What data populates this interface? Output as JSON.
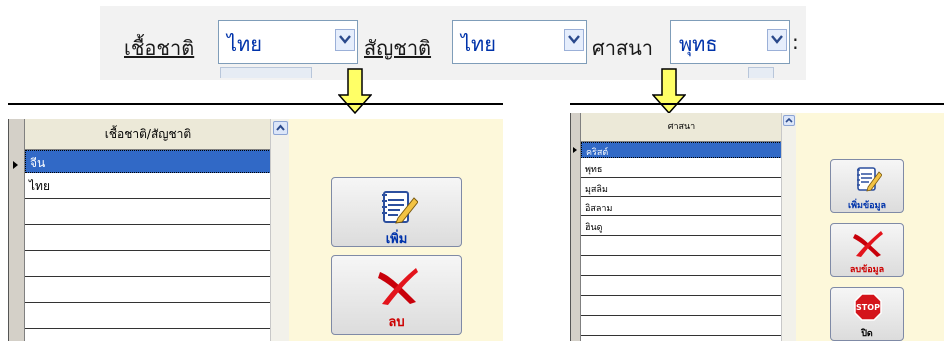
{
  "top_form": {
    "nationality_label": "เชื้อชาติ",
    "nationality_value": "ไทย",
    "citizenship_label": "สัญชาติ",
    "citizenship_value": "ไทย",
    "religion_label": "ศาสนา",
    "religion_value": "พุทธ",
    "trailing_char": ":"
  },
  "left_panel": {
    "column_header": "เชื้อชาติ/สัญชาติ",
    "rows": [
      "จีน",
      "ไทย",
      "",
      "",
      "",
      "",
      "",
      ""
    ],
    "add_button_label": "เพิ่ม",
    "delete_button_label": "ลบ"
  },
  "right_panel": {
    "column_header": "ศาสนา",
    "rows": [
      "คริสต์",
      "พุทธ",
      "มุสลิม",
      "อิสลาม",
      "ฮินดู",
      "",
      "",
      "",
      "",
      ""
    ],
    "add_button_label": "เพิ่มข้อมูล",
    "delete_button_label": "ลบข้อมูล",
    "stop_icon_text": "STOP",
    "close_button_label": "ปิด"
  },
  "colors": {
    "selected_row": "#3169c6",
    "button_label": "#cc0000",
    "add_label": "#0033aa",
    "arrow_fill": "#ffff66",
    "form_background": "#fdf8da"
  }
}
